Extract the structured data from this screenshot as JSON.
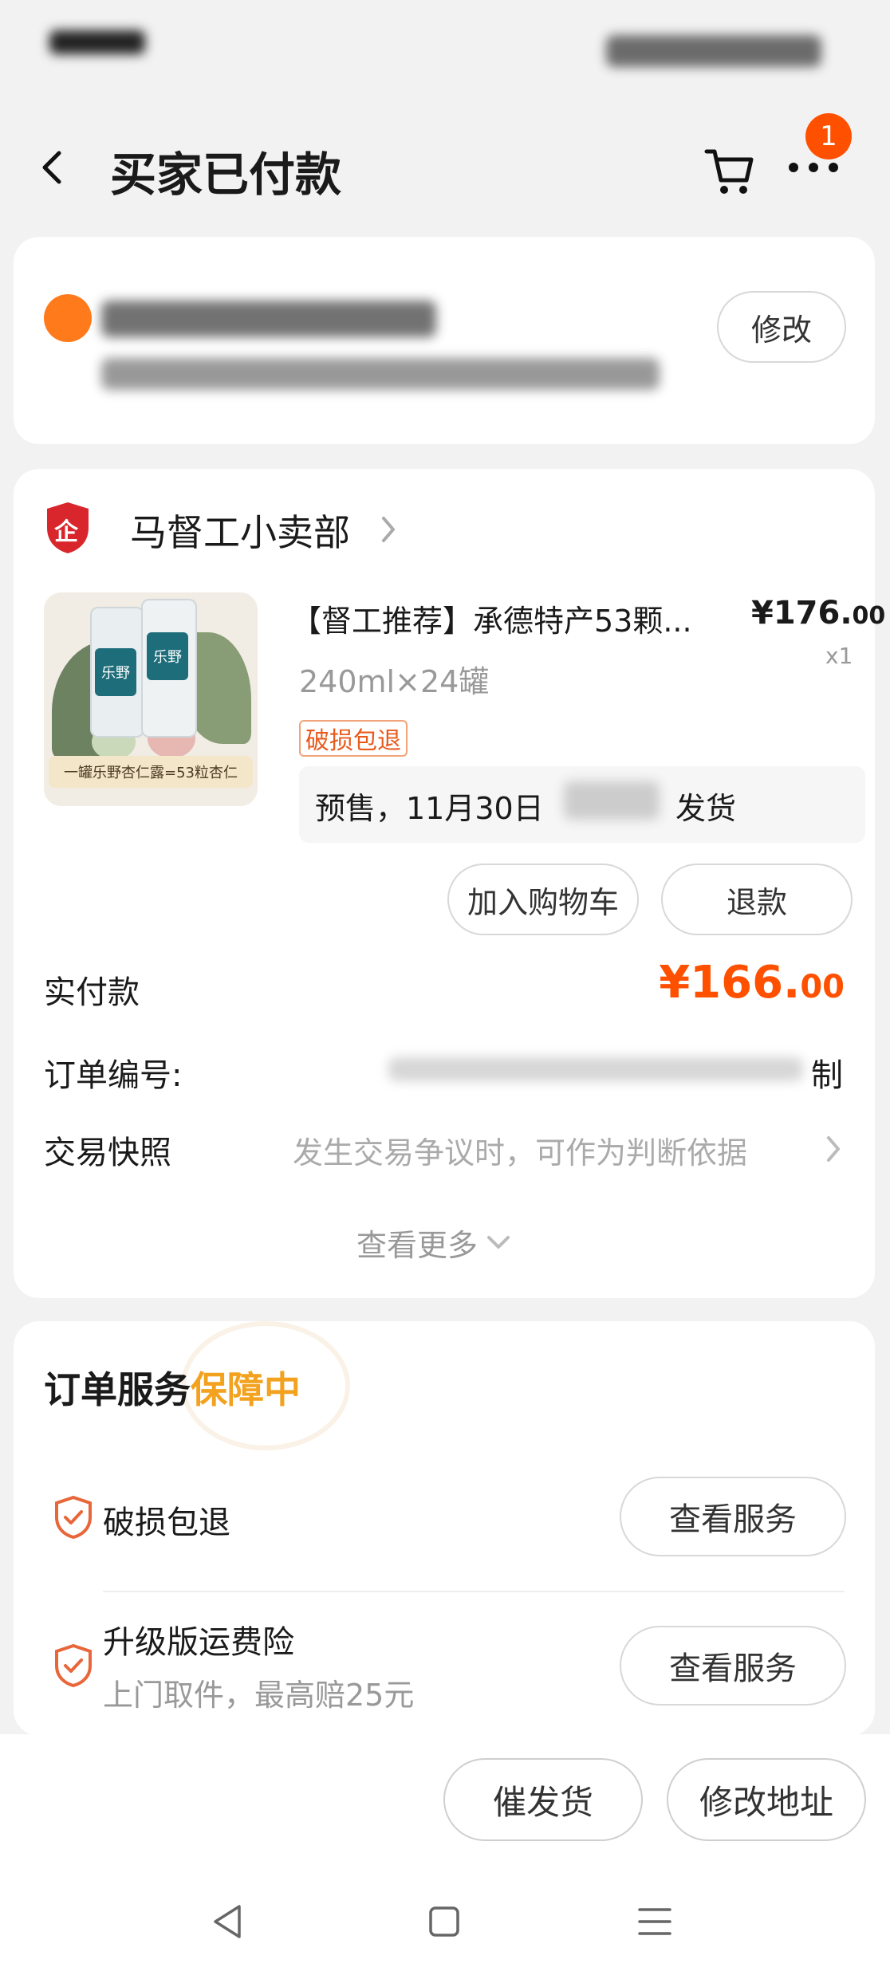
{
  "header": {
    "title": "买家已付款",
    "menu_badge": "1"
  },
  "address": {
    "edit_label": "修改"
  },
  "shop": {
    "name": "马督工小卖部",
    "badge": "企"
  },
  "product": {
    "title": "【督工推荐】承德特产53颗...",
    "price_main": "¥176.",
    "price_decimal": "00",
    "quantity": "x1",
    "spec": "240ml×24罐",
    "tag": "破损包退",
    "presale_note_start": "预售，11月30日",
    "presale_note_end": "发货",
    "image_caption": "一罐乐野杏仁露=53粒杏仁",
    "can_brand": "乐野",
    "add_to_cart_label": "加入购物车",
    "refund_label": "退款"
  },
  "order": {
    "paid_label": "实付款",
    "paid_main": "¥166.",
    "paid_decimal": "00",
    "number_label": "订单编号:",
    "number_tail": "制",
    "snapshot_label": "交易快照",
    "snapshot_hint": "发生交易争议时，可作为判断依据",
    "more_label": "查看更多"
  },
  "services": {
    "title_prefix": "订单服务",
    "title_status": "保障中",
    "items": [
      {
        "name": "破损包退",
        "desc": "",
        "button": "查看服务"
      },
      {
        "name": "升级版运费险",
        "desc": "上门取件，最高赔25元",
        "button": "查看服务"
      }
    ]
  },
  "bottom_bar": {
    "remind_label": "催发货",
    "change_address_label": "修改地址"
  },
  "colors": {
    "accent": "#ff5000",
    "gold": "#f3a21f",
    "shield_red": "#d9262c",
    "service_icon": "#e8663a"
  }
}
